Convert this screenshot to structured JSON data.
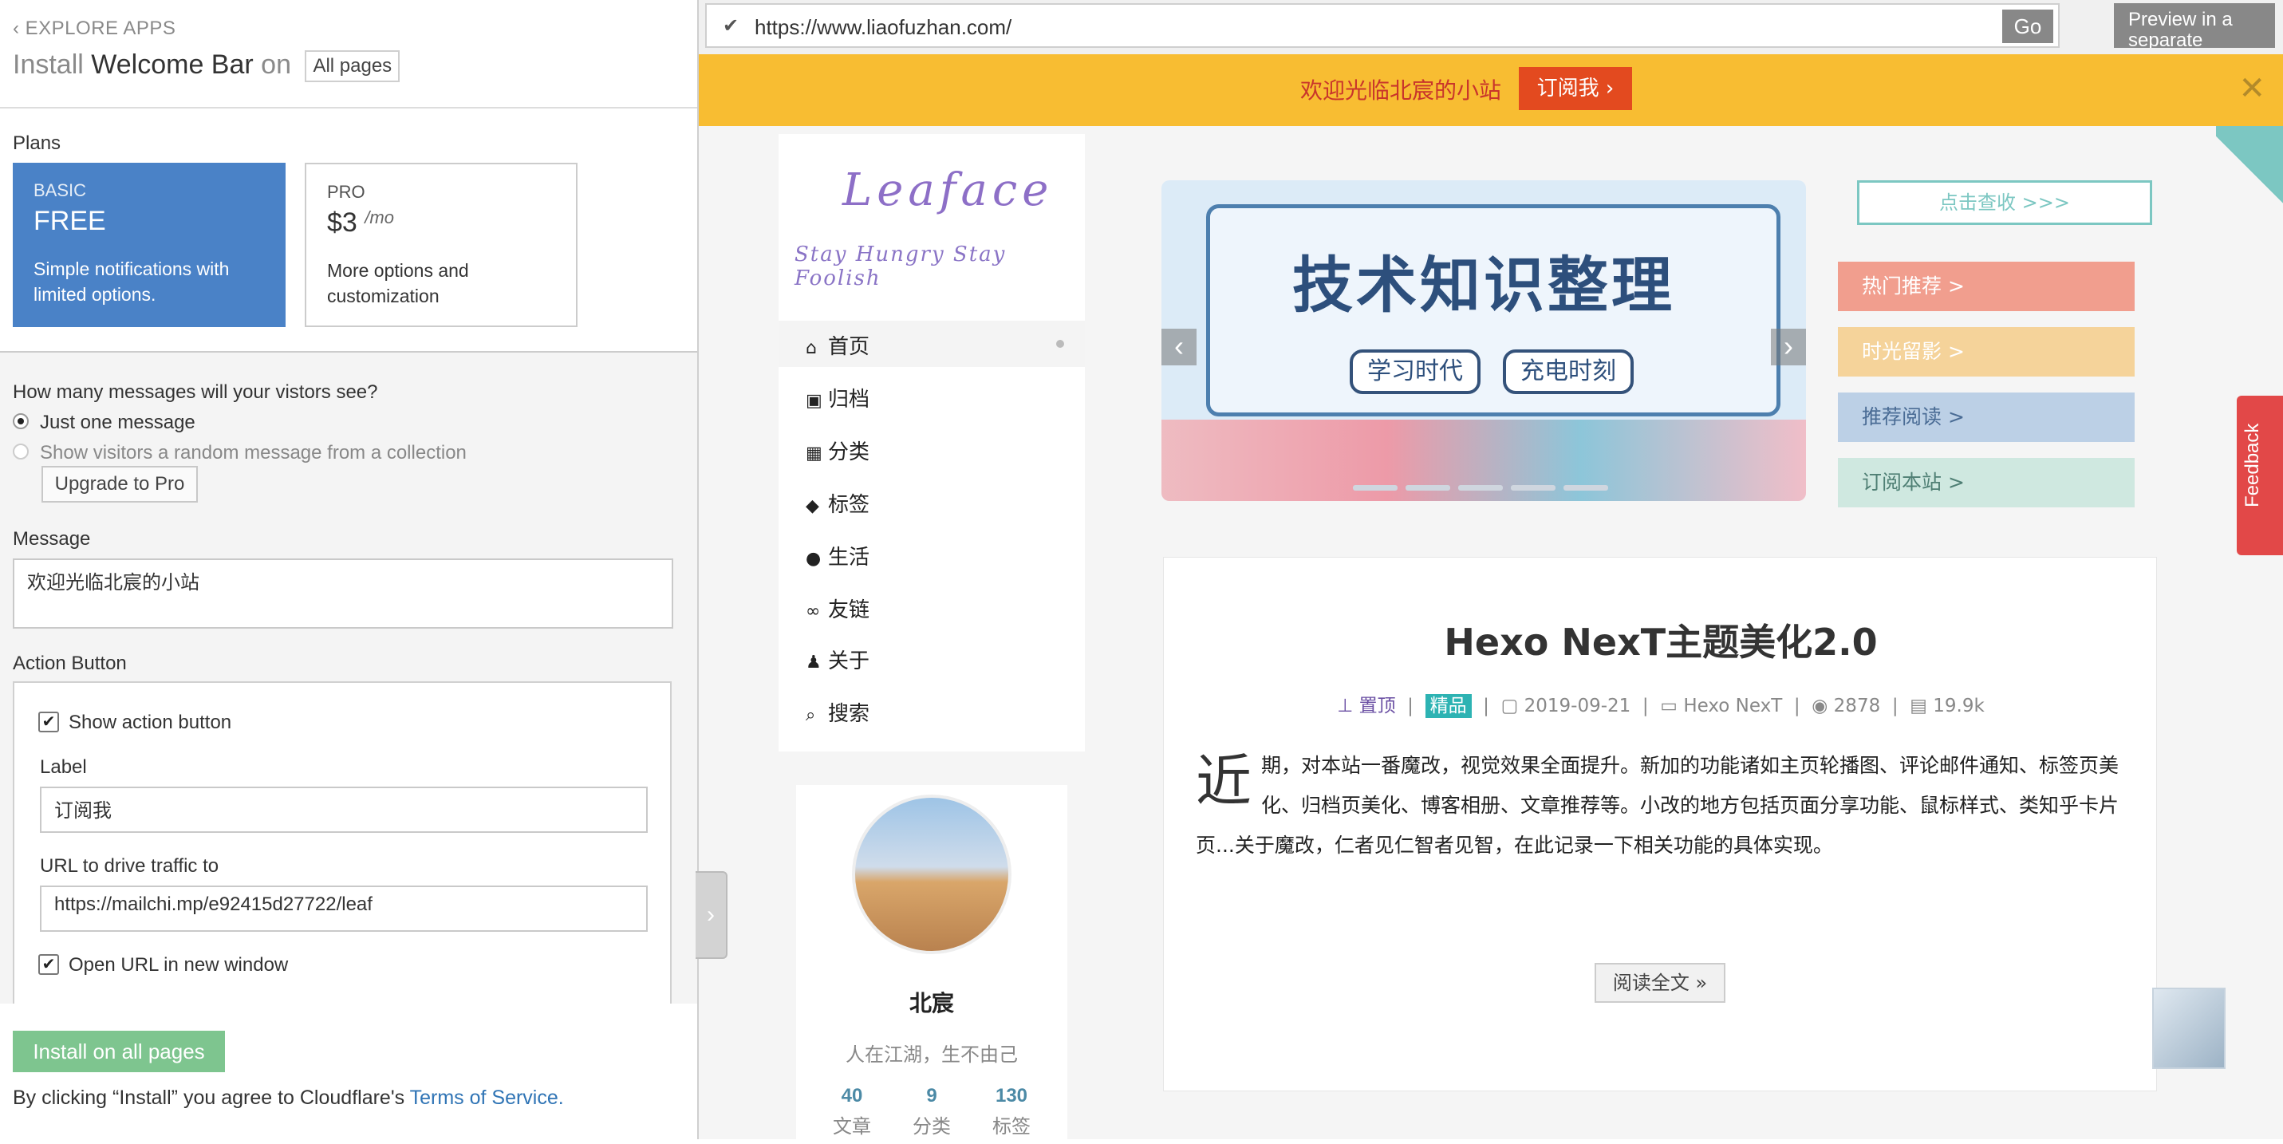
{
  "left": {
    "back_label": "‹ EXPLORE APPS",
    "title_prefix": "Install",
    "title_app": "Welcome Bar",
    "title_on": "on",
    "pages_select": "All pages",
    "plans_label": "Plans",
    "plans": [
      {
        "name": "BASIC",
        "price": "FREE",
        "desc": "Simple notifications with limited options."
      },
      {
        "name": "PRO",
        "price": "$3",
        "per": "/mo",
        "desc": "More options and customization"
      }
    ],
    "question": "How many messages will your vistors see?",
    "option_one": "Just one message",
    "option_two": "Show visitors a random message from a collection",
    "upgrade_button": "Upgrade to Pro",
    "message_label": "Message",
    "message_value": "欢迎光临北宸的小站",
    "action_label": "Action Button",
    "show_action": "Show action button",
    "label_label": "Label",
    "label_value": "订阅我",
    "url_label": "URL to drive traffic to",
    "url_value": "https://mailchi.mp/e92415d27722/leaf",
    "open_new": "Open URL in new window",
    "install_button": "Install on all pages",
    "terms_prefix": "By clicking “Install” you agree to Cloudflare's",
    "terms_link": "Terms of Service."
  },
  "browser": {
    "url": "https://www.liaofuzhan.com/",
    "go": "Go",
    "preview": "Preview in a separate"
  },
  "welcome_bar": {
    "message": "欢迎光临北宸的小站",
    "button": "订阅我 ›",
    "close": "✕"
  },
  "site": {
    "logo_title": "Leaface",
    "logo_tagline": "Stay Hungry Stay Foolish",
    "menu": [
      {
        "icon": "home-icon",
        "glyph": "⌂",
        "label": "首页"
      },
      {
        "icon": "archive-icon",
        "glyph": "▣",
        "label": "归档"
      },
      {
        "icon": "grid-icon",
        "glyph": "▦",
        "label": "分类"
      },
      {
        "icon": "tags-icon",
        "glyph": "◆",
        "label": "标签"
      },
      {
        "icon": "apple-icon",
        "glyph": "●",
        "label": "生活"
      },
      {
        "icon": "link-icon",
        "glyph": "∞",
        "label": "友链"
      },
      {
        "icon": "user-icon",
        "glyph": "♟",
        "label": "关于"
      },
      {
        "icon": "search-icon",
        "glyph": "⌕",
        "label": "搜索"
      }
    ],
    "banner_title": "技术知识整理",
    "banner_pills": [
      "学习时代",
      "充电时刻"
    ],
    "more_link": "点击查收 >>>",
    "cards": [
      {
        "label": "热门推荐 >",
        "color": "#f19e8e",
        "text": "#fff"
      },
      {
        "label": "时光留影 >",
        "color": "#f5d39a",
        "text": "#fff"
      },
      {
        "label": "推荐阅读 >",
        "color": "#bcd0e6",
        "text": "#4a6c95"
      },
      {
        "label": "订阅本站 >",
        "color": "#cfe8e0",
        "text": "#4f7f74"
      }
    ],
    "post": {
      "title": "Hexo NexT主题美化2.0",
      "pin": "置顶",
      "tag": "精品",
      "date": "2019-09-21",
      "category": "Hexo NexT",
      "views": "2878",
      "words": "19.9k",
      "dropcap": "近",
      "body": "期，对本站一番魔改，视觉效果全面提升。新加的功能诸如主页轮播图、评论邮件通知、标签页美化、归档页美化、博客相册、文章推荐等。小改的地方包括页面分享功能、鼠标样式、类知乎卡片页...关于魔改，仁者见仁智者见智，在此记录一下相关功能的具体实现。",
      "read_more": "阅读全文 »"
    },
    "profile": {
      "name": "北宸",
      "motto": "人在江湖，生不由己",
      "stats": [
        {
          "n": "40",
          "l": "文章"
        },
        {
          "n": "9",
          "l": "分类"
        },
        {
          "n": "130",
          "l": "标签"
        }
      ]
    },
    "feedback": "Feedback"
  }
}
